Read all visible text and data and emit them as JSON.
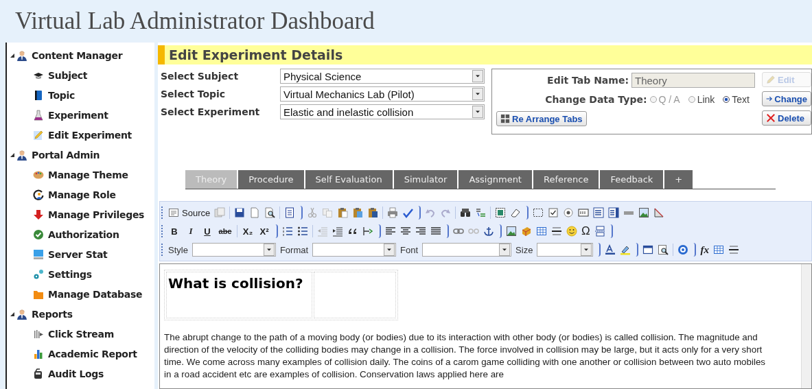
{
  "header": {
    "title": "Virtual Lab Administrator Dashboard"
  },
  "sidebar": {
    "groups": [
      {
        "label": "Content Manager",
        "expanded": true,
        "items": [
          "Subject",
          "Topic",
          "Experiment",
          "Edit Experiment"
        ]
      },
      {
        "label": "Portal Admin",
        "expanded": true,
        "items": [
          "Manage Theme",
          "Manage Role",
          "Manage Privileges",
          "Authorization",
          "Server Stat",
          "Settings",
          "Manage Database"
        ]
      },
      {
        "label": "Reports",
        "expanded": true,
        "items": [
          "Click Stream",
          "Academic Report",
          "Audit Logs"
        ]
      }
    ]
  },
  "section_title": "Edit Experiment Details",
  "selects": [
    {
      "label": "Select Subject",
      "value": "Physical Science"
    },
    {
      "label": "Select Topic",
      "value": "Virtual Mechanics Lab (Pilot)"
    },
    {
      "label": "Select Experiment",
      "value": "Elastic and inelastic collision"
    }
  ],
  "tab_editor": {
    "name_label": "Edit Tab Name:",
    "name_value": "Theory",
    "type_label": "Change Data Type:",
    "type_options": [
      {
        "label": "Q / A",
        "selected": false,
        "disabled": true
      },
      {
        "label": "Link",
        "selected": false,
        "disabled": false
      },
      {
        "label": "Text",
        "selected": true,
        "disabled": false
      }
    ],
    "buttons": [
      {
        "kind": "rearrange",
        "label": "Re Arrange Tabs",
        "disabled": false
      },
      {
        "kind": "edit",
        "label": "Edit",
        "disabled": true
      },
      {
        "kind": "change",
        "label": "Change",
        "disabled": false
      },
      {
        "kind": "delete",
        "label": "Delete",
        "disabled": false
      }
    ]
  },
  "tabs": [
    {
      "label": "Theory",
      "selected": true
    },
    {
      "label": "Procedure",
      "selected": false
    },
    {
      "label": "Self Evaluation",
      "selected": false
    },
    {
      "label": "Simulator",
      "selected": false
    },
    {
      "label": "Assignment",
      "selected": false
    },
    {
      "label": "Reference",
      "selected": false
    },
    {
      "label": "Feedback",
      "selected": false
    },
    {
      "label": "+",
      "selected": false
    }
  ],
  "toolbar": {
    "source_label": "Source",
    "format_buttons": [
      "B",
      "I",
      "U",
      "abc",
      "X₂",
      "X²"
    ],
    "omega": "Ω",
    "formula": "fx",
    "combos": [
      "Style",
      "Format",
      "Font",
      "Size"
    ]
  },
  "content": {
    "heading": "What is collision?",
    "paragraph": "The abrupt change to the path of a moving body (or bodies) due to its interaction with other body (or bodies) is called collision. The magnitude and direction of the velocity of the colliding bodies may change in a collision. The force involved in collision may be large, but it acts only for a very short time. We come across many examples of collision daily. The coins of a carom game colliding with one another or collision between two auto mobiles in a road accident etc are examples of collision. Conservation laws applied here are"
  }
}
